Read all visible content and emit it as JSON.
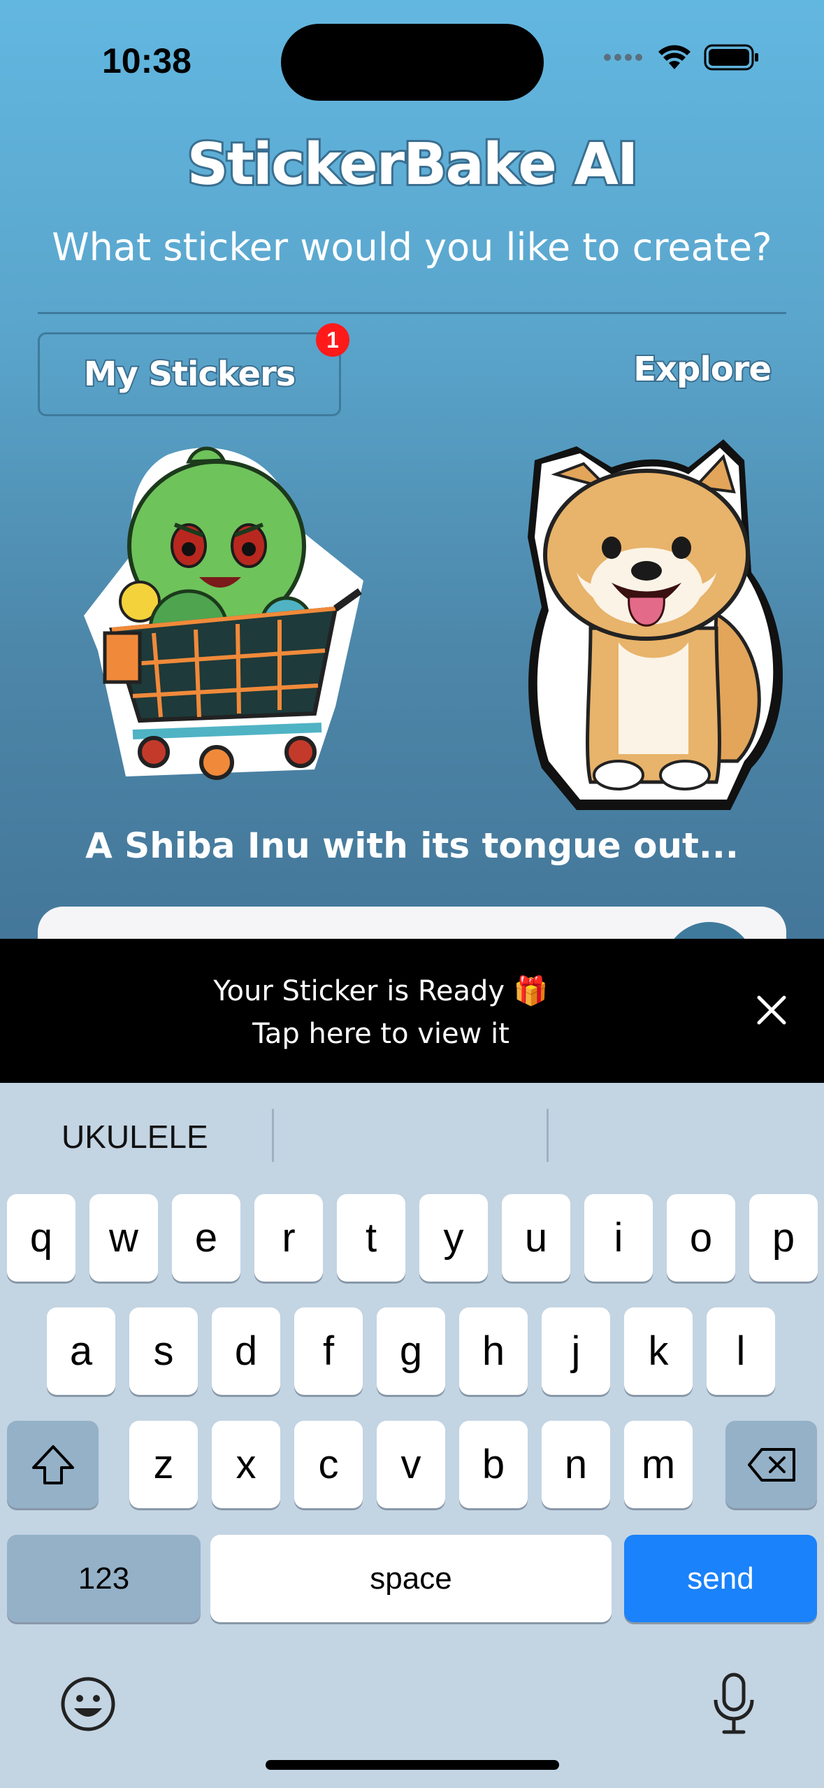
{
  "status_bar": {
    "time": "10:38",
    "icons": [
      "signal-icon",
      "wifi-icon",
      "battery-icon"
    ]
  },
  "header": {
    "title": "StickerBake AI",
    "subtitle": "What sticker would you like to create?"
  },
  "tabs": {
    "my_stickers": "My Stickers",
    "my_stickers_badge": "1",
    "explore": "Explore"
  },
  "stickers": [
    {
      "name": "green-creature-shopping-cart-sticker"
    },
    {
      "name": "shiba-inu-sticker"
    }
  ],
  "prompt_caption": "A Shiba Inu with its tongue out...",
  "toast": {
    "line1": "Your Sticker is Ready 🎁",
    "line2": "Tap here to view it"
  },
  "keyboard": {
    "suggestion": "UKULELE",
    "row1": [
      "q",
      "w",
      "e",
      "r",
      "t",
      "y",
      "u",
      "i",
      "o",
      "p"
    ],
    "row2": [
      "a",
      "s",
      "d",
      "f",
      "g",
      "h",
      "j",
      "k",
      "l"
    ],
    "row3": [
      "z",
      "x",
      "c",
      "v",
      "b",
      "n",
      "m"
    ],
    "numbers_key": "123",
    "space_key": "space",
    "send_key": "send"
  },
  "colors": {
    "accent_blue": "#1a82fb",
    "badge_red": "#ff1a1a",
    "bg_top": "#62b7e0",
    "bg_bottom": "#44779a"
  }
}
